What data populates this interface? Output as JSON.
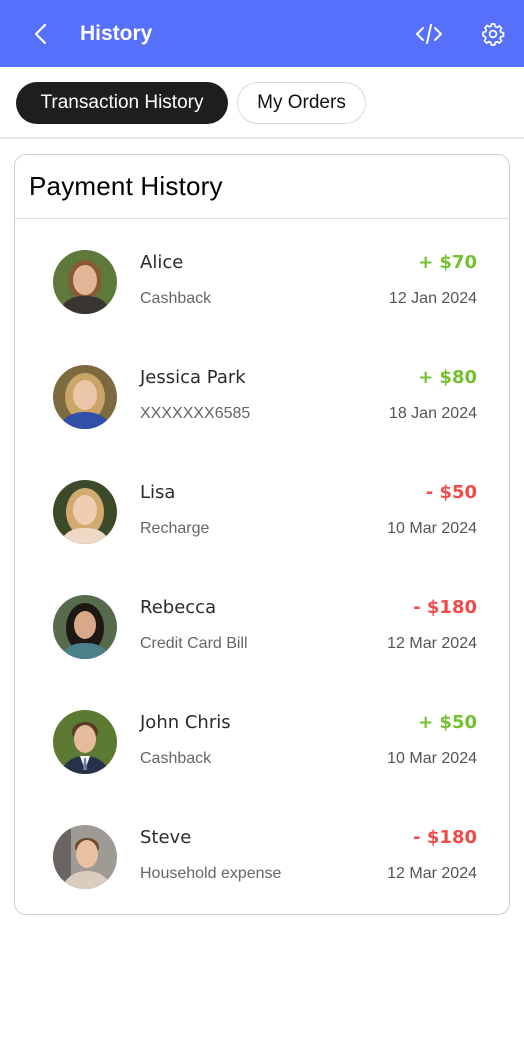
{
  "appbar": {
    "title": "History",
    "icons": [
      "chevron-left-icon",
      "code-icon",
      "gear-icon"
    ],
    "color": "#5770fb"
  },
  "tabs": [
    {
      "label": "Transaction History",
      "active": true
    },
    {
      "label": "My Orders",
      "active": false
    }
  ],
  "card": {
    "title": "Payment History"
  },
  "transactions": [
    {
      "name": "Alice",
      "description": "Cashback",
      "amount": "+ $70",
      "date": "12 Jan 2024",
      "type": "credit"
    },
    {
      "name": "Jessica Park",
      "description": "XXXXXXX6585",
      "amount": "+ $80",
      "date": "18 Jan 2024",
      "type": "credit"
    },
    {
      "name": "Lisa",
      "description": "Recharge",
      "amount": "- $50",
      "date": "10 Mar 2024",
      "type": "debit"
    },
    {
      "name": "Rebecca",
      "description": "Credit Card Bill",
      "amount": "- $180",
      "date": "12 Mar 2024",
      "type": "debit"
    },
    {
      "name": "John Chris",
      "description": "Cashback",
      "amount": "+ $50",
      "date": "10 Mar 2024",
      "type": "credit"
    },
    {
      "name": "Steve",
      "description": "Household expense",
      "amount": "- $180",
      "date": "12 Mar 2024",
      "type": "debit"
    }
  ],
  "colors": {
    "credit": "#72c12f",
    "debit": "#ef4b4b"
  }
}
